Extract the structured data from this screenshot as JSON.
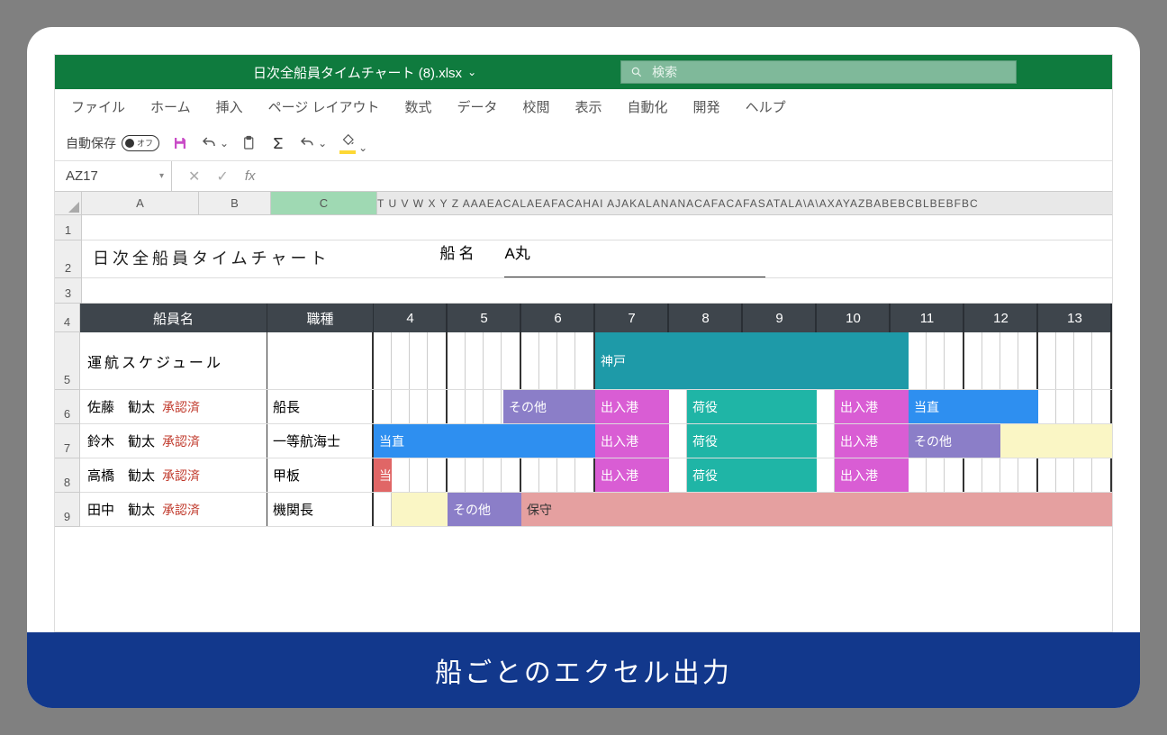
{
  "caption": "船ごとのエクセル出力",
  "titlebar": {
    "filename": "日次全船員タイムチャート (8).xlsx",
    "search_placeholder": "検索"
  },
  "ribbon": {
    "tabs": [
      "ファイル",
      "ホーム",
      "挿入",
      "ページ レイアウト",
      "数式",
      "データ",
      "校閲",
      "表示",
      "自動化",
      "開発",
      "ヘルプ"
    ]
  },
  "quickbar": {
    "autosave_label": "自動保存",
    "autosave_state": "オフ"
  },
  "formula": {
    "namebox": "AZ17",
    "fx": "fx"
  },
  "columns": {
    "A": "A",
    "B": "B",
    "C": "C",
    "rest": "T U V W X Y Z AAAEACALAEAFACAHAI AJAKALANANACAFACAFASATALA\\A\\AXAYAZBABEBCBLBEBFBC"
  },
  "sheet": {
    "title": "日次全船員タイムチャート",
    "ship_label": "船名",
    "ship_name": "A丸",
    "headers": {
      "crew": "船員名",
      "role": "職種"
    },
    "hours": [
      "4",
      "5",
      "6",
      "7",
      "8",
      "9",
      "10",
      "11",
      "12",
      "13"
    ],
    "schedule_label": "運航スケジュール",
    "schedule_port": "神戸",
    "rows": [
      {
        "name": "佐藤　勧太",
        "status": "承認済",
        "role": "船長"
      },
      {
        "name": "鈴木　勧太",
        "status": "承認済",
        "role": "一等航海士"
      },
      {
        "name": "高橋　勧太",
        "status": "承認済",
        "role": "甲板"
      },
      {
        "name": "田中　勧太",
        "status": "承認済",
        "role": "機関長"
      }
    ],
    "tasks": {
      "sonota": "その他",
      "deiriko": "出入港",
      "niyaku": "荷役",
      "tochoku": "当直",
      "to": "当",
      "hoshu": "保守"
    }
  },
  "rowNumbers": [
    "1",
    "2",
    "3",
    "4",
    "5",
    "6",
    "7",
    "8",
    "9"
  ]
}
